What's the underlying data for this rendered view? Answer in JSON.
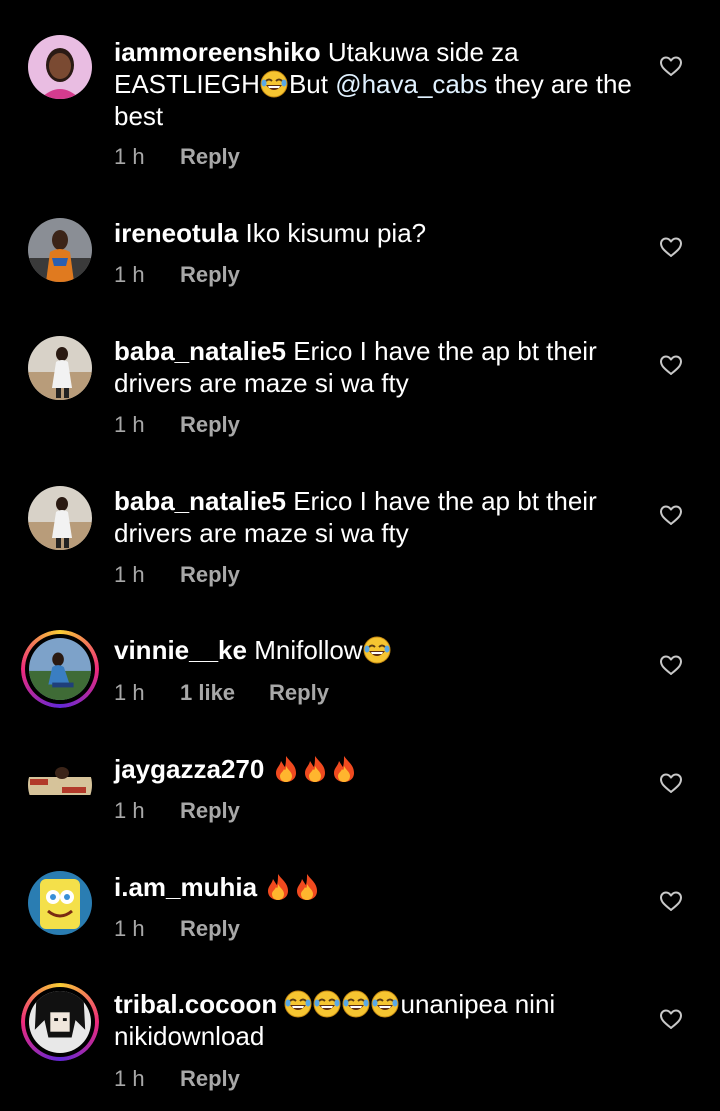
{
  "comments": [
    {
      "username": "iammoreenshiko",
      "text_a": "Utakuwa side za EASTLIEGH",
      "text_b": "But ",
      "mention": "@hava_cabs",
      "text_c": "  they are the best",
      "time": "1 h",
      "reply": "Reply",
      "avatar": "woman-portrait"
    },
    {
      "username": "ireneotula",
      "text": "Iko kisumu pia?",
      "time": "1 h",
      "reply": "Reply",
      "avatar": "person-portrait"
    },
    {
      "username": "baba_natalie5",
      "text": "Erico I have the ap bt their drivers are maze si wa fty",
      "time": "1 h",
      "reply": "Reply",
      "avatar": "outdoor-photo"
    },
    {
      "username": "baba_natalie5",
      "text": "Erico I have the ap bt their drivers are maze si wa fty",
      "time": "1 h",
      "reply": "Reply",
      "avatar": "outdoor-photo"
    },
    {
      "username": "vinnie__ke",
      "text": "Mnifollow",
      "time": "1 h",
      "likes": "1 like",
      "reply": "Reply",
      "avatar": "story-ring-photo"
    },
    {
      "username": "jaygazza270",
      "text": "",
      "time": "1 h",
      "reply": "Reply",
      "avatar": "logo-banner"
    },
    {
      "username": "i.am_muhia",
      "text": "",
      "time": "1 h",
      "reply": "Reply",
      "avatar": "cartoon-sponge"
    },
    {
      "username": "tribal.cocoon",
      "text": "unanipea nini nikidownload",
      "time": "1 h",
      "reply": "Reply",
      "avatar": "anime-character"
    }
  ],
  "icons": {
    "like": "heart-outline-icon",
    "laugh": "tears-of-joy-emoji",
    "fire": "fire-emoji"
  },
  "colors": {
    "background": "#000000",
    "text": "#ffffff",
    "meta": "#a8a8a8"
  }
}
